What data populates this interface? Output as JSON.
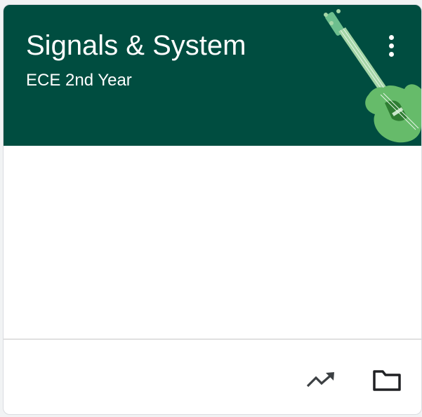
{
  "course_card": {
    "title": "Signals & System",
    "section": "ECE 2nd Year",
    "header_color": "#004d40",
    "illustration": "guitar-illustration",
    "menu_icon": "more-vert-icon",
    "actions": [
      {
        "icon": "trending-up-icon"
      },
      {
        "icon": "folder-icon"
      }
    ]
  }
}
